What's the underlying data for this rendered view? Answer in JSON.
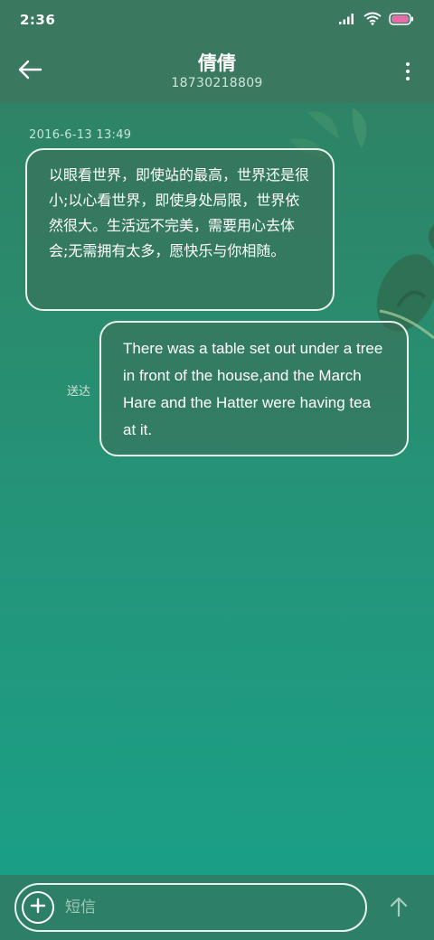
{
  "status_bar": {
    "time": "2:36"
  },
  "header": {
    "contact_name": "倩倩",
    "contact_number": "18730218809"
  },
  "conversation": {
    "timestamp": "2016-6-13 13:49",
    "messages": [
      {
        "direction": "incoming",
        "text": "以眼看世界，即使站的最高，世界还是很小;以心看世界，即使身处局限，世界依然很大。生活远不完美，需要用心去体会;无需拥有太多，愿快乐与你相随。"
      },
      {
        "direction": "outgoing",
        "text": "There was a table set out under a tree in front of the house,and the March Hare and the Hatter were having tea at it.",
        "status": "送达"
      }
    ]
  },
  "composer": {
    "placeholder": "短信"
  },
  "icons": {
    "back": "arrow-left-icon",
    "more": "more-vertical-icon",
    "add": "plus-circle-icon",
    "send": "arrow-up-icon",
    "signal": "signal-icon",
    "wifi": "wifi-icon",
    "battery": "battery-icon"
  },
  "colors": {
    "header_bg": "#3b7860",
    "battery_fill": "#e86aa8"
  }
}
